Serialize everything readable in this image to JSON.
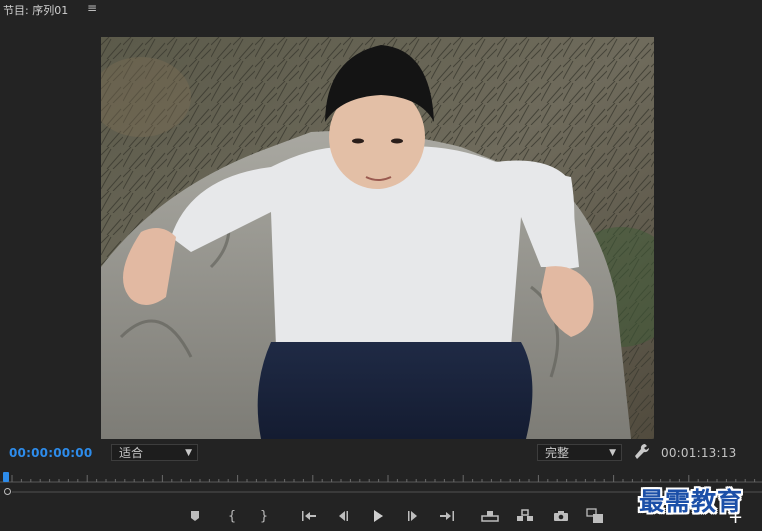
{
  "panel": {
    "title": "节目: 序列01",
    "menu_glyph": "≡"
  },
  "viewer": {
    "content": "photo-boy-sitting-on-rock"
  },
  "controls": {
    "current_timecode": "00:00:00:00",
    "zoom_value": "适合",
    "quality_value": "完整",
    "duration_timecode": "00:01:13:13"
  },
  "playhead": {
    "position_fraction": 0
  },
  "transport": {
    "buttons": [
      {
        "name": "add-marker-button",
        "icon": "marker-icon"
      },
      {
        "name": "mark-in-button",
        "icon": "mark-in-icon",
        "glyph": "{"
      },
      {
        "name": "mark-out-button",
        "icon": "mark-out-icon",
        "glyph": "}"
      },
      {
        "name": "go-to-in-button",
        "icon": "go-to-in-icon"
      },
      {
        "name": "step-back-button",
        "icon": "step-back-icon"
      },
      {
        "name": "play-button",
        "icon": "play-icon"
      },
      {
        "name": "step-forward-button",
        "icon": "step-forward-icon"
      },
      {
        "name": "go-to-out-button",
        "icon": "go-to-out-icon"
      },
      {
        "name": "lift-button",
        "icon": "lift-icon"
      },
      {
        "name": "extract-button",
        "icon": "extract-icon"
      },
      {
        "name": "export-frame-button",
        "icon": "camera-icon"
      },
      {
        "name": "compare-view-button",
        "icon": "compare-icon"
      }
    ],
    "add_glyph": "+"
  },
  "watermark": {
    "text": "最需教育"
  },
  "colors": {
    "accent_blue": "#2d8ceb",
    "panel_bg": "#232323",
    "watermark_blue": "#1b4fa8"
  }
}
